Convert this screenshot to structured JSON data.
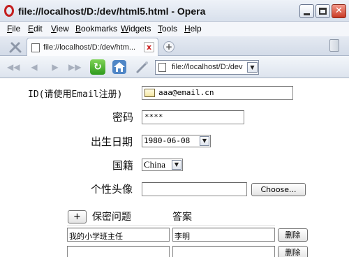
{
  "window": {
    "title": "file://localhost/D:/dev/html5.html - Opera"
  },
  "menubar": [
    "File",
    "Edit",
    "View",
    "Bookmarks",
    "Widgets",
    "Tools",
    "Help"
  ],
  "tab": {
    "title": "file://localhost/D:/dev/htm...",
    "close": "x",
    "new_tab": "+"
  },
  "navbar": {
    "address": "file://localhost/D:/dev"
  },
  "form": {
    "id_label": "ID(请使用Email注册)",
    "id_value": "aaa@email.cn",
    "password_label": "密码",
    "password_value": "****",
    "birthdate_label": "出生日期",
    "birthdate_value": "1980-06-08",
    "country_label": "国籍",
    "country_value": "China",
    "avatar_label": "个性头像",
    "avatar_button": "Choose...",
    "questions": {
      "add_button": "+",
      "question_header": "保密问题",
      "answer_header": "答案",
      "rows": [
        {
          "question": "我的小学班主任",
          "answer": "李明",
          "delete_label": "删除"
        },
        {
          "question": "",
          "answer": "",
          "delete_label": "删除"
        }
      ]
    }
  }
}
